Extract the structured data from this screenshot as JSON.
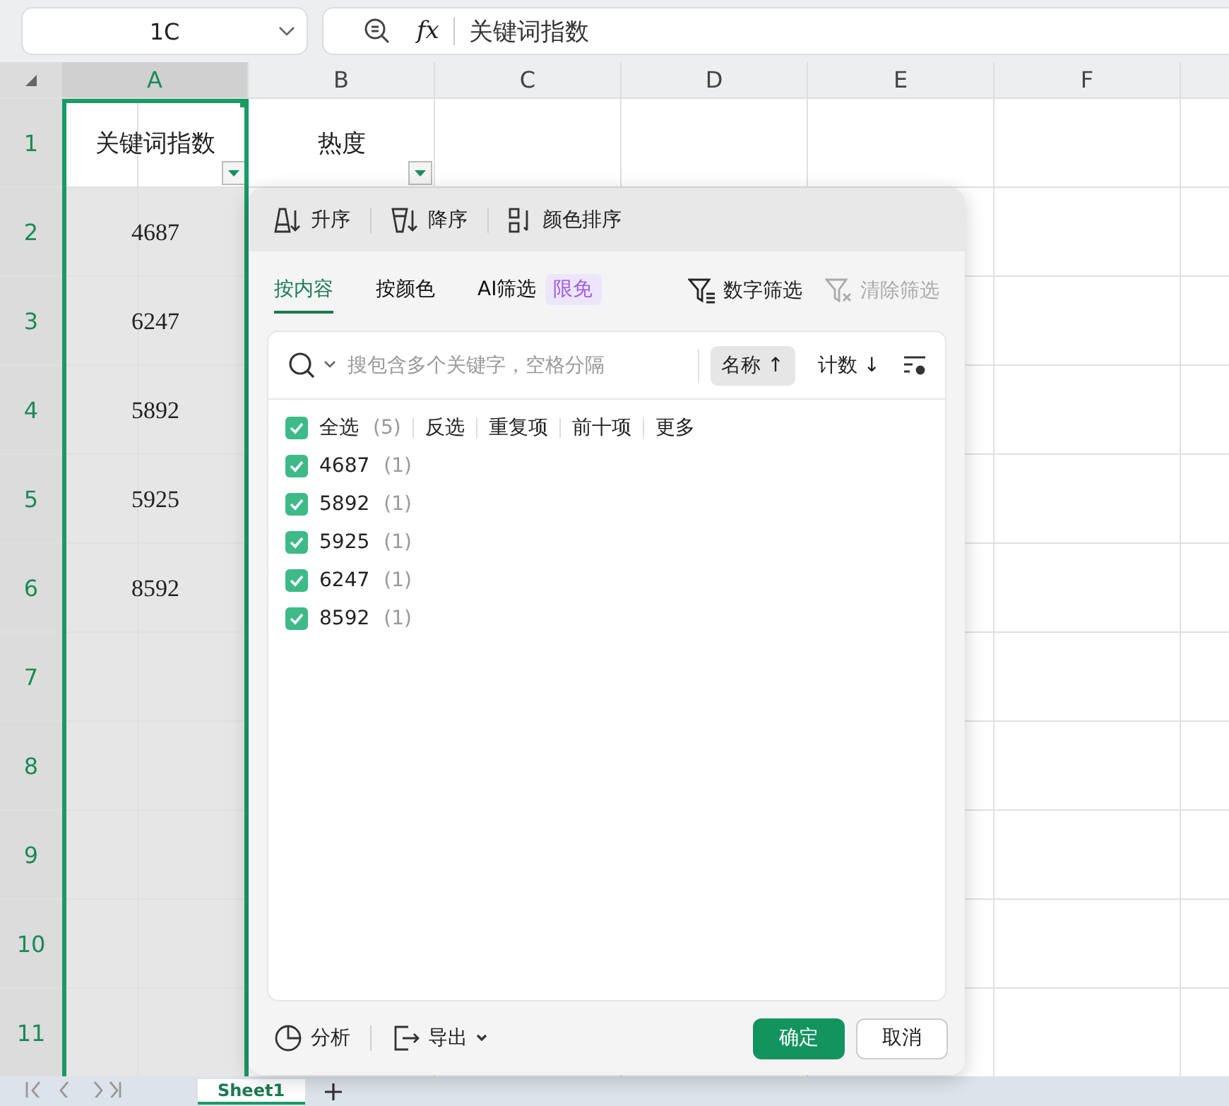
{
  "name_box": {
    "value": "1C"
  },
  "formula_bar": {
    "fx": "fx",
    "value": "关键词指数"
  },
  "columns": [
    {
      "label": "A",
      "selected": true
    },
    {
      "label": "B",
      "selected": false
    },
    {
      "label": "C",
      "selected": false
    },
    {
      "label": "D",
      "selected": false
    },
    {
      "label": "E",
      "selected": false
    },
    {
      "label": "F",
      "selected": false
    }
  ],
  "rows": [
    {
      "label": "1",
      "cells": [
        {
          "text": "关键词指数",
          "filter": true
        },
        {
          "text": "热度",
          "filter": true
        }
      ]
    },
    {
      "label": "2",
      "cells": [
        {
          "text": "4687"
        }
      ]
    },
    {
      "label": "3",
      "cells": [
        {
          "text": "6247"
        }
      ]
    },
    {
      "label": "4",
      "cells": [
        {
          "text": "5892"
        }
      ]
    },
    {
      "label": "5",
      "cells": [
        {
          "text": "5925"
        }
      ]
    },
    {
      "label": "6",
      "cells": [
        {
          "text": "8592"
        }
      ]
    },
    {
      "label": "7"
    },
    {
      "label": "8"
    },
    {
      "label": "9"
    },
    {
      "label": "10"
    },
    {
      "label": "11"
    }
  ],
  "filter_panel": {
    "sort_buttons": [
      {
        "kind": "asc",
        "label": "升序"
      },
      {
        "kind": "desc",
        "label": "降序"
      },
      {
        "kind": "color",
        "label": "颜色排序"
      }
    ],
    "tabs": [
      {
        "label": "按内容",
        "selected": true
      },
      {
        "label": "按颜色",
        "selected": false
      },
      {
        "label": "AI筛选",
        "selected": false,
        "badge": "限免"
      }
    ],
    "number_filter": {
      "label": "数字筛选",
      "disabled": false
    },
    "clear_filter": {
      "label": "清除筛选",
      "disabled": true
    },
    "search": {
      "placeholder": "搜包含多个关键字，空格分隔"
    },
    "sort_by": [
      {
        "label": "名称",
        "arrow": "↑",
        "selected": true
      },
      {
        "label": "计数",
        "arrow": "↓",
        "selected": false
      }
    ],
    "select_all": {
      "label": "全选",
      "count": "(5)",
      "checked": true
    },
    "actions": [
      "反选",
      "重复项",
      "前十项",
      "更多"
    ],
    "items": [
      {
        "value": "4687",
        "count": "(1)",
        "checked": true
      },
      {
        "value": "5892",
        "count": "(1)",
        "checked": true
      },
      {
        "value": "5925",
        "count": "(1)",
        "checked": true
      },
      {
        "value": "6247",
        "count": "(1)",
        "checked": true
      },
      {
        "value": "8592",
        "count": "(1)",
        "checked": true
      }
    ],
    "analyze": "分析",
    "export": "导出",
    "ok": "确定",
    "cancel": "取消"
  },
  "sheet_tabs": [
    {
      "label": "Sheet1",
      "selected": true
    }
  ]
}
